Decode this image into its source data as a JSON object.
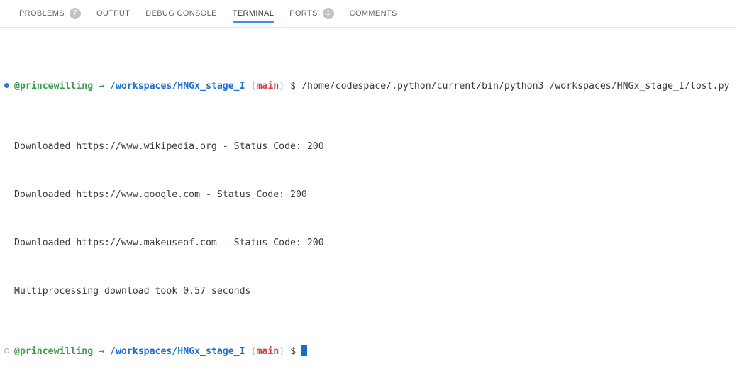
{
  "panel": {
    "tabs": [
      {
        "label": "PROBLEMS",
        "badge": "7",
        "active": false
      },
      {
        "label": "OUTPUT",
        "badge": null,
        "active": false
      },
      {
        "label": "DEBUG CONSOLE",
        "badge": null,
        "active": false
      },
      {
        "label": "TERMINAL",
        "badge": null,
        "active": true
      },
      {
        "label": "PORTS",
        "badge": "1",
        "active": false
      },
      {
        "label": "COMMENTS",
        "badge": null,
        "active": false
      }
    ]
  },
  "terminal": {
    "prompt": {
      "user": "@princewilling",
      "arrow": "→",
      "path": "/workspaces/HNGx_stage_I",
      "paren_open": "(",
      "branch": "main",
      "paren_close": ")",
      "dollar": "$"
    },
    "command": "/home/codespace/.python/current/bin/python3 /workspaces/HNGx_stage_I/lost.py",
    "output_lines": [
      "Downloaded https://www.wikipedia.org - Status Code: 200",
      "Downloaded https://www.google.com - Status Code: 200",
      "Downloaded https://www.makeuseof.com - Status Code: 200",
      "Multiprocessing download took 0.57 seconds"
    ],
    "colors": {
      "user": "#3f9c4f",
      "path": "#1f6fd0",
      "branch": "#d2424a",
      "paren": "#7fb3e8",
      "output": "#3b3b3b",
      "cursor": "#176bcb",
      "bullet_active": "#2f7fd1",
      "accent_underline": "#3b8eea",
      "badge_bg": "#c4c4c4"
    }
  }
}
